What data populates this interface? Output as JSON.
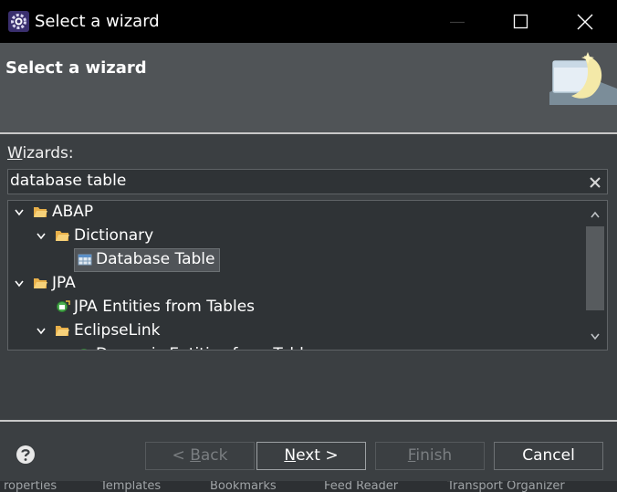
{
  "window": {
    "title": "Select a wizard",
    "app_icon": "eclipse-gear-icon",
    "controls": [
      "minimize-icon",
      "maximize-icon",
      "close-icon"
    ]
  },
  "banner": {
    "title": "Select a wizard",
    "graphic": "wizard-banner-icon"
  },
  "wizards": {
    "label_prefix": "W",
    "label_rest": "izards:",
    "filter_value": "database table",
    "clear_icon": "clear-icon",
    "tree": [
      {
        "level": 0,
        "expanded": true,
        "icon": "folder-icon",
        "label": "ABAP"
      },
      {
        "level": 1,
        "expanded": true,
        "icon": "folder-icon",
        "label": "Dictionary"
      },
      {
        "level": 2,
        "icon": "database-table-icon",
        "label": "Database Table",
        "selected": true
      },
      {
        "level": 0,
        "expanded": true,
        "icon": "folder-icon",
        "label": "JPA"
      },
      {
        "level": 1,
        "icon": "jpa-entities-icon",
        "label": "JPA Entities from Tables"
      },
      {
        "level": 1,
        "expanded": true,
        "icon": "folder-icon",
        "label": "EclipseLink"
      },
      {
        "level": 2,
        "icon": "jpa-entities-icon",
        "label": "Dynamic Entities from Tables"
      }
    ]
  },
  "buttons": {
    "back": {
      "mnemonic": "B",
      "pre": "< ",
      "post": "ack",
      "enabled": false
    },
    "next": {
      "mnemonic": "N",
      "pre": "",
      "post": "ext >",
      "enabled": true
    },
    "finish": {
      "mnemonic": "F",
      "pre": "",
      "post": "inish",
      "enabled": false
    },
    "cancel": {
      "label": "Cancel",
      "enabled": true
    },
    "help_icon": "help-icon"
  },
  "background_strip": [
    "roperties",
    "Templates",
    "Bookmarks",
    "Feed Reader",
    "Transport Organizer"
  ],
  "colors": {
    "titlebar": "#000000",
    "banner": "#505457",
    "body": "#3b3f42",
    "field": "#2f3336",
    "folder": "#e8b04a"
  }
}
